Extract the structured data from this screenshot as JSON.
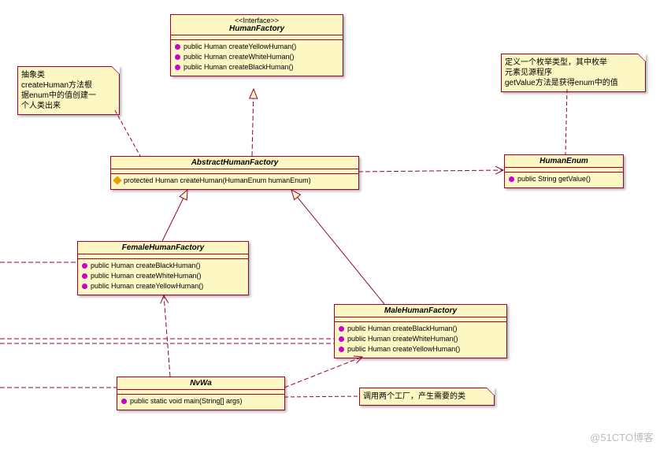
{
  "interface": {
    "stereotype": "<<Interface>>",
    "name": "HumanFactory",
    "ops": [
      "public Human createYellowHuman()",
      "public Human createWhiteHuman()",
      "public Human createBlackHuman()"
    ]
  },
  "abstractFactory": {
    "name": "AbstractHumanFactory",
    "ops": [
      "protected Human createHuman(HumanEnum humanEnum)"
    ]
  },
  "humanEnum": {
    "name": "HumanEnum",
    "ops": [
      "public String getValue()"
    ]
  },
  "femaleFactory": {
    "name": "FemaleHumanFactory",
    "ops": [
      "public Human createBlackHuman()",
      "public Human createWhiteHuman()",
      "public Human createYellowHuman()"
    ]
  },
  "maleFactory": {
    "name": "MaleHumanFactory",
    "ops": [
      "public Human createBlackHuman()",
      "public Human createWhiteHuman()",
      "public Human createYellowHuman()"
    ]
  },
  "nvwa": {
    "name": "NvWa",
    "ops": [
      "public static void main(String[] args)"
    ]
  },
  "notes": {
    "leftTop": "抽象类\ncreateHuman方法根\n据enum中的值创建一\n个人类出来",
    "rightTop": "定义一个枚举类型，其中枚举\n元素见源程序\ngetValue方法是获得enum中的值",
    "bottom": "调用两个工厂，产生需要的类"
  },
  "watermark": "@51CTO博客"
}
